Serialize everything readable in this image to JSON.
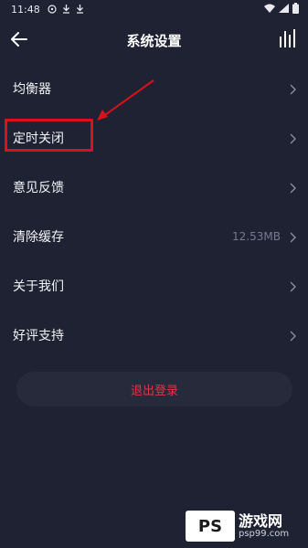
{
  "status_bar": {
    "time": "11:48",
    "left_icons": [
      "sync-icon",
      "download-icon",
      "download-icon"
    ],
    "right_icons": [
      "wifi-icon",
      "signal-icon",
      "battery-icon"
    ]
  },
  "header": {
    "title": "系统设置",
    "back_icon": "arrow-left-icon",
    "right_icon": "equalizer-bars-icon"
  },
  "menu": [
    {
      "label": "均衡器",
      "value": ""
    },
    {
      "label": "定时关闭",
      "value": ""
    },
    {
      "label": "意见反馈",
      "value": ""
    },
    {
      "label": "清除缓存",
      "value": "12.53MB"
    },
    {
      "label": "关于我们",
      "value": ""
    },
    {
      "label": "好评支持",
      "value": ""
    }
  ],
  "logout_label": "退出登录",
  "annotation": {
    "highlighted_item": "定时关闭",
    "color": "#d9111a"
  },
  "watermark": {
    "logo_text": "PS",
    "site_name": "游戏网",
    "url": "psp99.com"
  },
  "colors": {
    "background": "#1f2233",
    "logout_text": "#e0344a",
    "secondary_text": "#767a8c"
  }
}
